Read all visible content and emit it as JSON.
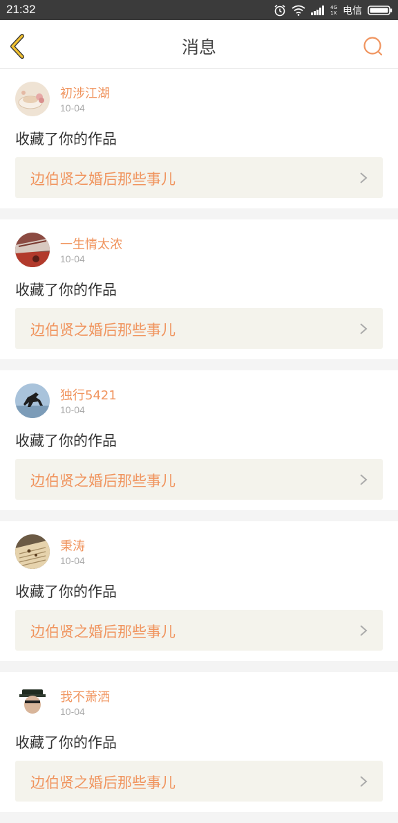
{
  "status_bar": {
    "time": "21:32",
    "network_top": "4G",
    "network_bottom": "1X",
    "carrier": "电信",
    "icons": [
      "alarm-icon",
      "wifi-icon",
      "signal-icon",
      "battery-icon"
    ]
  },
  "header": {
    "title": "消息",
    "back_icon": "back-chevron-icon",
    "search_icon": "search-icon"
  },
  "colors": {
    "accent": "#f0945e",
    "back_icon": "#f0c030",
    "card_link_bg": "#f4f3ec",
    "status_bar": "#3b3b3b"
  },
  "messages": [
    {
      "username": "初涉江湖",
      "date": "10-04",
      "action": "收藏了你的作品",
      "work_title": "边伯贤之婚后那些事儿"
    },
    {
      "username": "一生情太浓",
      "date": "10-04",
      "action": "收藏了你的作品",
      "work_title": "边伯贤之婚后那些事儿"
    },
    {
      "username": "独行5421",
      "date": "10-04",
      "action": "收藏了你的作品",
      "work_title": "边伯贤之婚后那些事儿"
    },
    {
      "username": "秉涛",
      "date": "10-04",
      "action": "收藏了你的作品",
      "work_title": "边伯贤之婚后那些事儿"
    },
    {
      "username": "我不萧洒",
      "date": "10-04",
      "action": "收藏了你的作品",
      "work_title": "边伯贤之婚后那些事儿"
    }
  ]
}
